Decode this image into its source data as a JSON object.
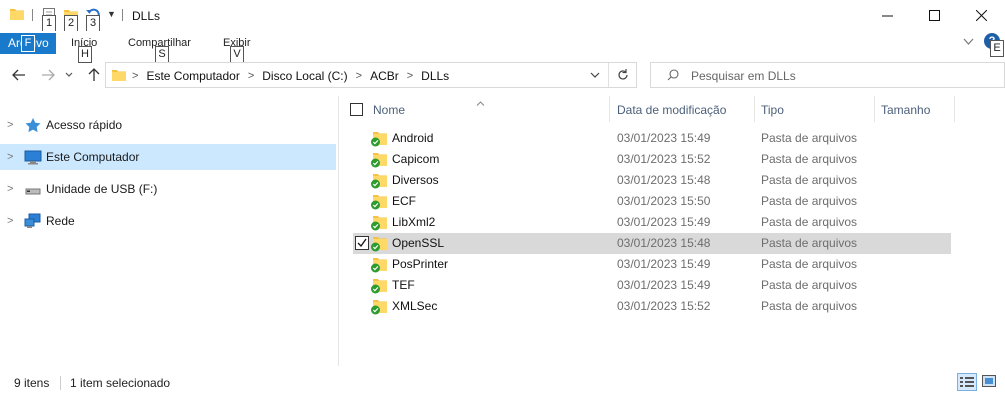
{
  "window": {
    "title": "DLLs",
    "keytips_qa": [
      "1",
      "2",
      "3"
    ]
  },
  "ribbon": {
    "file_tab": "Arquivo",
    "file_keytip": "F",
    "tabs": [
      {
        "label": "Início",
        "keytip": "H"
      },
      {
        "label": "Compartilhar",
        "keytip": "S"
      },
      {
        "label": "Exibir",
        "keytip": "V"
      }
    ],
    "help_keytip": "E"
  },
  "address": {
    "crumbs": [
      "Este Computador",
      "Disco Local (C:)",
      "ACBr",
      "DLLs"
    ]
  },
  "search": {
    "placeholder": "Pesquisar em DLLs"
  },
  "nav": {
    "items": [
      {
        "label": "Acesso rápido",
        "icon": "star-icon",
        "selected": false
      },
      {
        "label": "Este Computador",
        "icon": "computer-icon",
        "selected": true
      },
      {
        "label": "Unidade de USB (F:)",
        "icon": "usb-drive-icon",
        "selected": false
      },
      {
        "label": "Rede",
        "icon": "network-icon",
        "selected": false
      }
    ]
  },
  "columns": {
    "name": "Nome",
    "date": "Data de modificação",
    "type": "Tipo",
    "size": "Tamanho"
  },
  "files": [
    {
      "name": "Android",
      "date": "03/01/2023 15:49",
      "type": "Pasta de arquivos",
      "selected": false
    },
    {
      "name": "Capicom",
      "date": "03/01/2023 15:52",
      "type": "Pasta de arquivos",
      "selected": false
    },
    {
      "name": "Diversos",
      "date": "03/01/2023 15:48",
      "type": "Pasta de arquivos",
      "selected": false
    },
    {
      "name": "ECF",
      "date": "03/01/2023 15:50",
      "type": "Pasta de arquivos",
      "selected": false
    },
    {
      "name": "LibXml2",
      "date": "03/01/2023 15:49",
      "type": "Pasta de arquivos",
      "selected": false
    },
    {
      "name": "OpenSSL",
      "date": "03/01/2023 15:48",
      "type": "Pasta de arquivos",
      "selected": true
    },
    {
      "name": "PosPrinter",
      "date": "03/01/2023 15:49",
      "type": "Pasta de arquivos",
      "selected": false
    },
    {
      "name": "TEF",
      "date": "03/01/2023 15:49",
      "type": "Pasta de arquivos",
      "selected": false
    },
    {
      "name": "XMLSec",
      "date": "03/01/2023 15:52",
      "type": "Pasta de arquivos",
      "selected": false
    }
  ],
  "status": {
    "count": "9 itens",
    "selected": "1 item selecionado"
  },
  "colors": {
    "accent": "#1979ca",
    "nav_selected": "#cce8ff",
    "row_selected": "#d9d9d9",
    "folder": "#f5c242",
    "sync_green": "#2e9b2e"
  }
}
